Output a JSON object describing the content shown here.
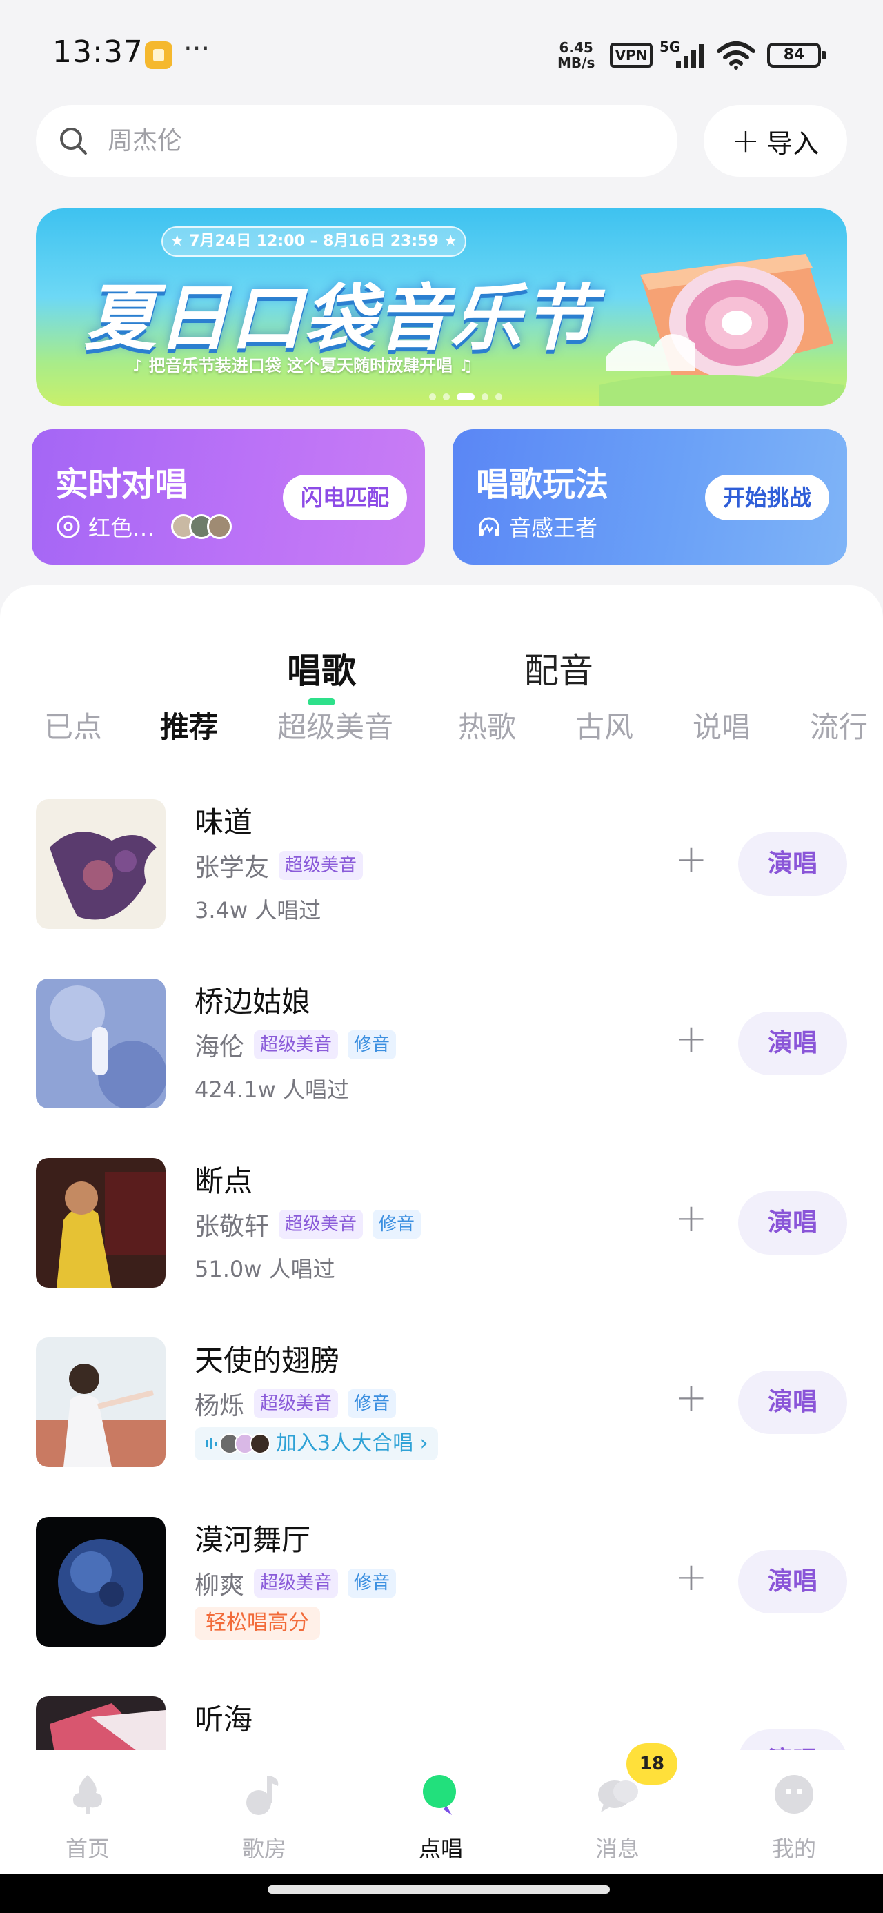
{
  "status_bar": {
    "time": "13:37",
    "more": "···",
    "speed_top": "6.45",
    "speed_bottom": "MB/s",
    "vpn": "VPN",
    "network": "5G",
    "battery": "84"
  },
  "search": {
    "placeholder": "周杰伦",
    "import_label": "导入"
  },
  "banner": {
    "date_range": "★ 7月24日 12:00 – 8月16日 23:59 ★",
    "title": "夏日口袋音乐节",
    "subtitle": "♪ 把音乐节装进口袋 这个夏天随时放肆开唱 ♫"
  },
  "feature_cards": {
    "duet": {
      "title": "实时对唱",
      "subtitle": "红色…",
      "button": "闪电匹配"
    },
    "play": {
      "title": "唱歌玩法",
      "subtitle": "音感王者",
      "button": "开始挑战"
    }
  },
  "main_tabs": [
    {
      "label": "唱歌",
      "active": true
    },
    {
      "label": "配音",
      "active": false
    }
  ],
  "categories": [
    {
      "label": "已点",
      "active": false
    },
    {
      "label": "推荐",
      "active": true
    },
    {
      "label": "超级美音",
      "active": false
    },
    {
      "label": "热歌",
      "active": false
    },
    {
      "label": "古风",
      "active": false
    },
    {
      "label": "说唱",
      "active": false
    },
    {
      "label": "流行",
      "active": false
    }
  ],
  "songs": [
    {
      "name": "味道",
      "artist": "张学友",
      "tags": [
        "超级美音"
      ],
      "line3": "3.4w 人唱过",
      "sing": "演唱"
    },
    {
      "name": "桥边姑娘",
      "artist": "海伦",
      "tags": [
        "超级美音",
        "修音"
      ],
      "line3": "424.1w 人唱过",
      "sing": "演唱"
    },
    {
      "name": "断点",
      "artist": "张敬轩",
      "tags": [
        "超级美音",
        "修音"
      ],
      "line3": "51.0w 人唱过",
      "sing": "演唱"
    },
    {
      "name": "天使的翅膀",
      "artist": "杨烁",
      "tags": [
        "超级美音",
        "修音"
      ],
      "line3": "加入3人大合唱 ›",
      "sing": "演唱"
    },
    {
      "name": "漠河舞厅",
      "artist": "柳爽",
      "tags": [
        "超级美音",
        "修音"
      ],
      "line3": "轻松唱高分",
      "sing": "演唱"
    },
    {
      "name": "听海",
      "artist": "",
      "tags": [],
      "line3": "",
      "sing": "演唱"
    }
  ],
  "bottom_nav": [
    {
      "label": "首页",
      "icon": "home-icon",
      "active": false
    },
    {
      "label": "歌房",
      "icon": "music-note-icon",
      "active": false
    },
    {
      "label": "点唱",
      "icon": "mic-icon",
      "active": true
    },
    {
      "label": "消息",
      "icon": "chat-icon",
      "active": false
    },
    {
      "label": "我的",
      "icon": "profile-icon",
      "active": false
    }
  ],
  "message_badge": "18",
  "colors": {
    "accent_green": "#2ee08a",
    "sing_purple": "#8a55d8",
    "duet_card": "#a466f5",
    "play_card": "#5a86f5",
    "badge_yellow": "#ffe03a"
  }
}
